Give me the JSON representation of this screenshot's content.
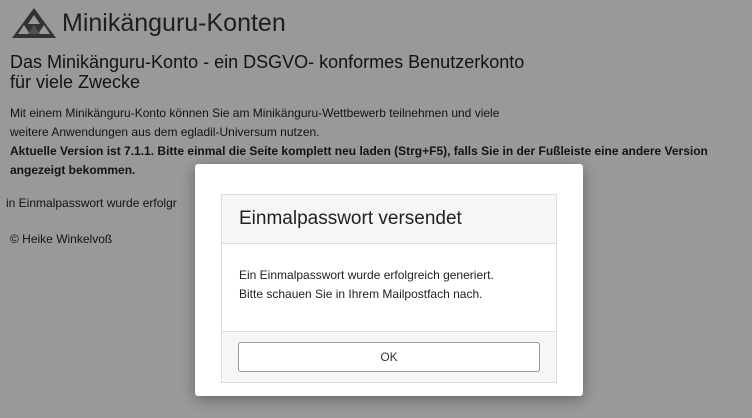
{
  "header": {
    "app_title": "Minikänguru-Konten",
    "logo_icon": "triangle-pattern-logo-icon"
  },
  "main": {
    "headline_line1": "Das Minikänguru-Konto - ein DSGVO- konformes Benutzerkonto",
    "headline_line2": "für viele Zwecke",
    "intro_line1": "Mit einem Minikänguru-Konto können Sie am Minikänguru-Wettbewerb teilnehmen und viele",
    "intro_line2": "weitere Anwendungen aus dem egladil-Universum nutzen.",
    "version_notice": "Aktuelle Version ist 7.1.1. Bitte einmal die Seite komplett neu laden (Strg+F5), falls Sie in der Fußleiste eine andere Version angezeigt bekommen.",
    "status_message": "in Einmalpasswort wurde erfolgr",
    "copyright": "© Heike Winkelvoß"
  },
  "dialog": {
    "title": "Einmalpasswort versendet",
    "message_line1": "Ein Einmalpasswort wurde erfolgreich generiert.",
    "message_line2": "Bitte schauen Sie in Ihrem Mailpostfach nach.",
    "ok_label": "OK"
  },
  "colors": {
    "overlay": "#000000",
    "background": "#ffffff",
    "text": "#222222"
  }
}
